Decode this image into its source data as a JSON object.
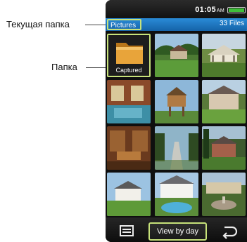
{
  "annotations": {
    "current_folder": "Текущая папка",
    "folder": "Папка"
  },
  "status_bar": {
    "time": "01:05",
    "ampm": "AM",
    "battery_icon": "battery-icon"
  },
  "title_bar": {
    "folder_name": "Pictures",
    "file_count": "33 Files"
  },
  "grid": {
    "folder_label": "Captured",
    "thumbnails": [
      "landscape-house-lawn",
      "pavilion-garden",
      "living-room-interior",
      "wooden-playhouse",
      "mansion-lawn",
      "library-room",
      "driveway-trees",
      "brick-house-trees",
      "white-house-lawn",
      "pool-house",
      "garden-fountain"
    ]
  },
  "bottom_bar": {
    "menu_icon": "menu-icon",
    "view_button": "View by day",
    "back_icon": "back-arrow-icon"
  },
  "colors": {
    "highlight": "#c7e27a",
    "title_bar": "#1c74be",
    "battery": "#3fbf3a"
  }
}
